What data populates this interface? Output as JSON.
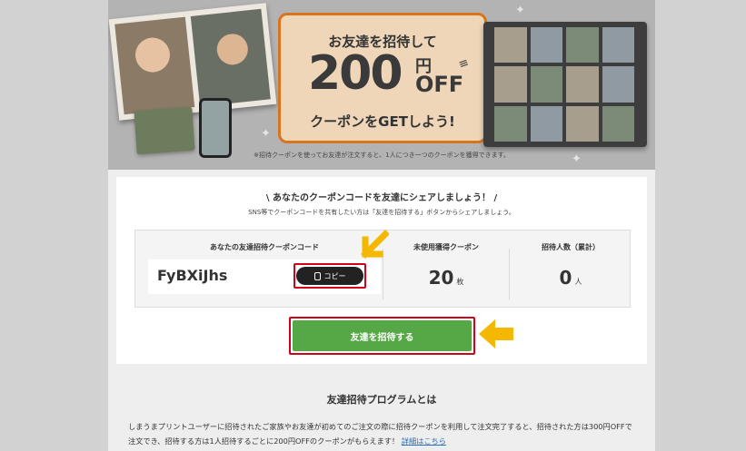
{
  "banner": {
    "promo_line1": "お友達を招待して",
    "promo_amount": "200",
    "promo_yen": "円",
    "promo_off": "OFF",
    "promo_line3": "クーポンをGETしよう!",
    "note": "※招待クーポンを使ってお友達が注文すると、1人につき一つのクーポンを獲得できます。"
  },
  "share": {
    "headline": "\\ あなたのクーポンコードを友達にシェアしましょう！ /",
    "subtext": "SNS等でクーポンコードを共有したい方は「友達を招待する」ボタンからシェアしましょう。",
    "code_label": "あなたの友達招待クーポンコード",
    "code_value": "FyBXiJhs",
    "copy_label": "コピー",
    "unused_label": "未使用獲得クーポン",
    "unused_value": "20",
    "unused_unit": "枚",
    "invited_label": "招待人数（累計）",
    "invited_value": "0",
    "invited_unit": "人",
    "invite_button": "友達を招待する"
  },
  "program": {
    "title": "友達招待プログラムとは",
    "body": "しまうまプリントユーザーに招待されたご家族やお友達が初めてのご注文の際に招待クーポンを利用して注文完了すると、招待された方は300円OFFで注文でき、招待する方は1人招待するごとに200円OFFのクーポンがもらえます！",
    "details_link": "詳細はこちら"
  },
  "colors": {
    "accent_orange": "#d8751c",
    "invite_green": "#55a845",
    "highlight_red": "#d0021b",
    "arrow_yellow": "#f5b800"
  }
}
